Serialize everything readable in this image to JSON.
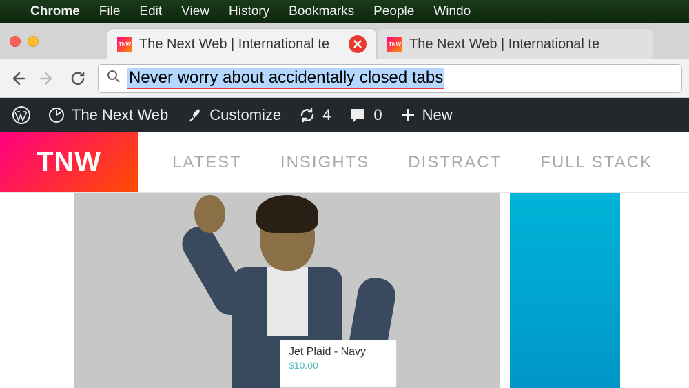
{
  "menubar": {
    "app_name": "Chrome",
    "items": [
      "File",
      "Edit",
      "View",
      "History",
      "Bookmarks",
      "People",
      "Windo"
    ]
  },
  "tabs": [
    {
      "title": "The Next Web | International te",
      "favicon_text": "TNW",
      "active": true
    },
    {
      "title": "The Next Web | International te",
      "favicon_text": "TNW",
      "active": false
    }
  ],
  "omnibox": {
    "text": "Never worry about accidentally closed tabs"
  },
  "wpbar": {
    "site_name": "The Next Web",
    "customize": "Customize",
    "updates": "4",
    "comments": "0",
    "new": "New"
  },
  "sitenav": {
    "logo_text": "TNW",
    "links": [
      "LATEST",
      "INSIGHTS",
      "DISTRACT",
      "FULL STACK"
    ]
  },
  "product_card": {
    "title": "Jet Plaid - Navy",
    "price": "$10.00"
  }
}
